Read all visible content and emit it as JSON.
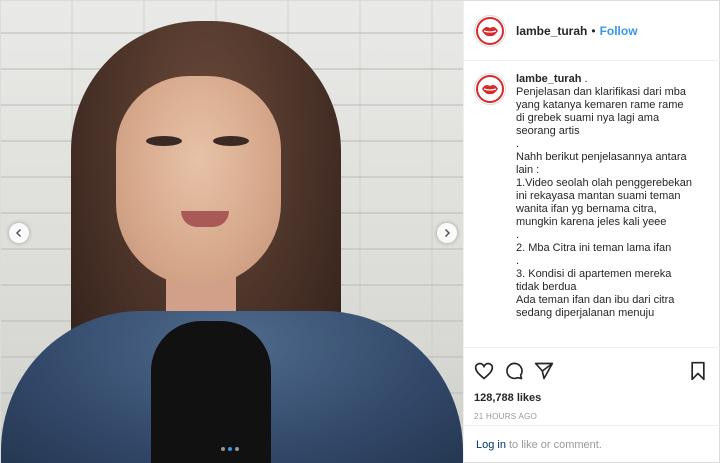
{
  "post": {
    "username": "lambe_turah",
    "separator": "•",
    "follow_label": "Follow"
  },
  "media": {
    "carousel_count": 3,
    "carousel_active_index": 1
  },
  "caption": {
    "username": "lambe_turah",
    "lines": [
      " .",
      "Penjelasan dan klarifikasi dari mba",
      "yang katanya kemaren rame rame",
      "di grebek suami nya lagi ama",
      "seorang artis",
      ".",
      "Nahh berikut penjelasannya antara",
      "lain :",
      "1.Video seolah olah penggerebekan",
      "ini rekayasa mantan suami teman",
      "wanita ifan yg bernama citra,",
      "mungkin karena jeles kali yeee",
      ".",
      "2. Mba Citra ini teman lama ifan",
      ".",
      "3. Kondisi di apartemen mereka",
      "tidak berdua",
      "Ada teman ifan dan ibu dari citra",
      "sedang diperjalanan menuju"
    ]
  },
  "stats": {
    "likes": "128,788 likes",
    "time": "21 HOURS AGO"
  },
  "login": {
    "link": "Log in",
    "text": "to like or comment."
  },
  "colors": {
    "link_blue": "#3897f0",
    "login_link": "#003569",
    "avatar_ring": "#d62b2b"
  }
}
